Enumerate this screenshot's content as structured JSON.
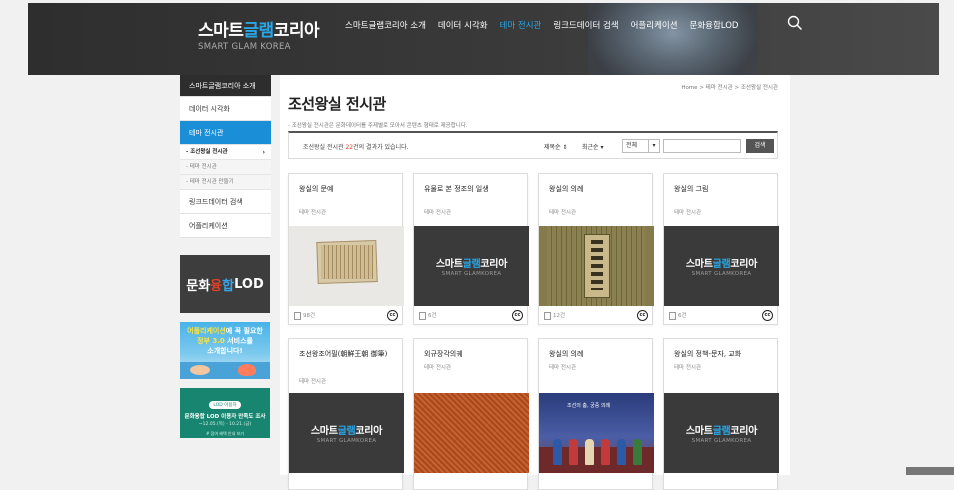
{
  "header": {
    "logo_ko_parts": [
      "스마트",
      "글램",
      "코리아"
    ],
    "logo_en": "SMART GLAM KOREA",
    "nav": [
      {
        "label": "스마트글램코리아 소개",
        "active": false
      },
      {
        "label": "데이터 시각화",
        "active": false
      },
      {
        "label": "테마 전시관",
        "active": true
      },
      {
        "label": "링크드데이터 검색",
        "active": false
      },
      {
        "label": "어플리케이션",
        "active": false
      },
      {
        "label": "문화융합LOD",
        "active": false
      }
    ],
    "search_icon": "search-icon"
  },
  "sidebar": {
    "items": [
      {
        "label": "스마트글램코리아 소개",
        "style": "dark"
      },
      {
        "label": "데이터 시각화",
        "style": "normal"
      },
      {
        "label": "테마 전시관",
        "style": "blue"
      }
    ],
    "subitems": [
      {
        "label": "- 조선왕실 전시관",
        "active": true,
        "arrow": "›"
      },
      {
        "label": "- 테마 전시관",
        "active": false
      },
      {
        "label": "- 테마 전시관 만들기",
        "active": false
      }
    ],
    "items_after": [
      {
        "label": "링크드데이터 검색"
      },
      {
        "label": "어플리케이션"
      }
    ]
  },
  "banners": {
    "lod": {
      "parts": [
        "문화",
        "융",
        "합",
        "LOD"
      ]
    },
    "app": {
      "line1_a": "어플리케이션",
      "line1_b": "에 꼭 필요한",
      "line2_a": "정부 3.0",
      "line2_b": " 서비스를",
      "line3": "소개합니다!"
    },
    "survey": {
      "tag": "LOD 이용자",
      "title": "문화융합 LOD 이용자 만족도 조사",
      "date": "~12.05.(목) - 10.21.(금)",
      "foot": "# 참여 혜택 안내 보기"
    }
  },
  "main": {
    "breadcrumb": "Home > 테마 전시관 > 조선왕실 전시관",
    "title": "조선왕실 전시관",
    "desc": "- 조선왕실 전시관은 문화데이터를 주제별로 모아서 콘텐츠 형태로 제공합니다.",
    "result_prefix": "조선왕실 전시관 ",
    "result_count": "22",
    "result_suffix": "건의 결과가 있습니다.",
    "sort1": "제목순 ⇕",
    "sort2": "최근순 ▾",
    "filter": {
      "value": "전체",
      "arrow": "▾"
    },
    "search_placeholder": "",
    "search_button": "검색"
  },
  "cards": [
    {
      "title": "왕실의 문예",
      "category": "테마 전시관",
      "count": "98건",
      "license": "cc",
      "image": "book"
    },
    {
      "title": "유물로 본 정조의 일생",
      "category": "테마 전시관",
      "count": "6건",
      "license": "cc",
      "image": "placeholder"
    },
    {
      "title": "왕실의 의례",
      "category": "테마 전시관",
      "count": "12건",
      "license": "cc",
      "image": "silk"
    },
    {
      "title": "왕실의 그림",
      "category": "테마 전시관",
      "count": "6건",
      "license": "cc",
      "image": "placeholder"
    },
    {
      "title": "조선왕조어필(朝鮮王朝 御筆)",
      "category": "테마 전시관",
      "image": "placeholder"
    },
    {
      "title": "외규장각의궤",
      "category": "테마 전시관",
      "image": "fabric"
    },
    {
      "title": "왕실의 의례",
      "category": "테마 전시관",
      "image": "ceremony"
    },
    {
      "title": "왕실의 정책-문자, 교화",
      "category": "테마 전시관",
      "image": "placeholder"
    }
  ],
  "placeholder": {
    "ko_parts": [
      "스마트",
      "글램",
      "코리아"
    ],
    "en": "SMART GLAMKOREA"
  },
  "ceremony_caption": "조선의 춤, 궁중 의례",
  "colors": {
    "accent_blue": "#1a8fd8",
    "count_red": "#e0402a",
    "header_dark": "#2e2e2e"
  }
}
